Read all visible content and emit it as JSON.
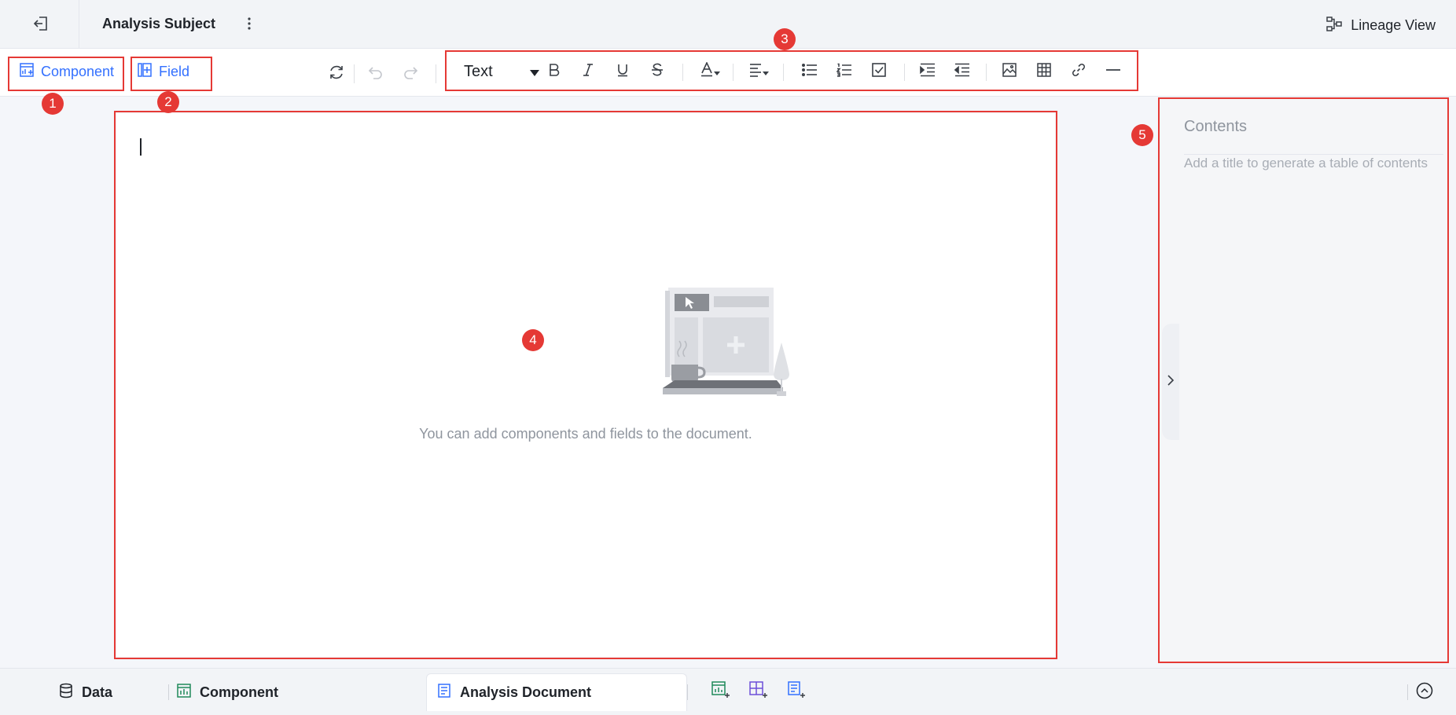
{
  "header": {
    "title": "Analysis Subject",
    "lineage_label": "Lineage View"
  },
  "toolbar": {
    "component_label": "Component",
    "field_label": "Field",
    "text_style": "Text"
  },
  "editor": {
    "empty_message": "You can add components and fields to the document."
  },
  "contents": {
    "title": "Contents",
    "hint": "Add a title to generate a table of contents"
  },
  "bottom_tabs": {
    "data": "Data",
    "component": "Component",
    "document": "Analysis Document"
  },
  "annotations": [
    "1",
    "2",
    "3",
    "4",
    "5"
  ],
  "colors": {
    "accent": "#3370ff",
    "annotation": "#e53935"
  }
}
